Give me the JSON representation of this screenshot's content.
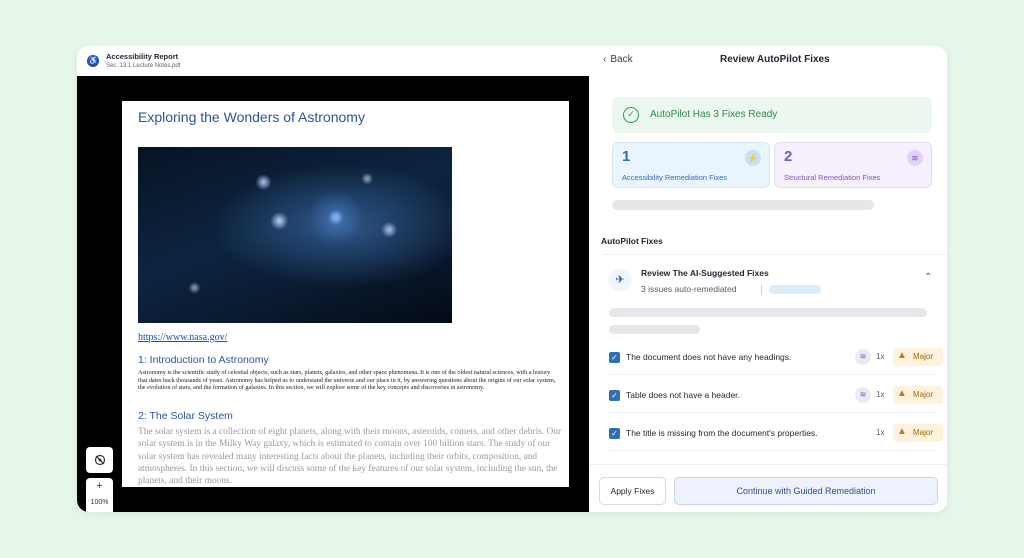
{
  "header": {
    "report_title": "Accessibility Report",
    "file_name": "Sec. 13.1 Lecture Notes.pdf"
  },
  "document": {
    "title": "Exploring the Wonders of Astronomy",
    "link": "https://www.nasa.gov/",
    "sections": [
      {
        "heading": "1: Introduction to Astronomy",
        "body": "Astronomy is the scientific study of celestial objects, such as stars, planets, galaxies, and other space phenomena. It is one of the oldest natural sciences, with a history that dates back thousands of years. Astronomy has helped us to understand the universe and our place in it, by answering questions about the origins of our solar system, the evolution of stars, and the formation of galaxies. In this section, we will explore some of the key concepts and discoveries in astronomy."
      },
      {
        "heading": "2: The Solar System",
        "body": "The solar system is a collection of eight planets, along with their moons, asteroids, comets, and other debris. Our solar system is in the Milky Way galaxy, which is estimated to contain over 100 billion stars. The study of our solar system has revealed many interesting facts about the planets, including their orbits, composition, and atmospheres. In this section, we will discuss some of the key features of our solar system, including the sun, the planets, and their moons."
      }
    ]
  },
  "viewer_controls": {
    "zoom_in": "+",
    "zoom_level": "100%",
    "zoom_out": "−"
  },
  "panel": {
    "back_label": "Back",
    "title": "Review AutoPilot Fixes",
    "ready_message": "AutoPilot Has 3 Fixes Ready",
    "cards": [
      {
        "count": "1",
        "label": "Accessibility Remediation Fixes",
        "icon": "lightning-icon"
      },
      {
        "count": "2",
        "label": "Structural Remediation Fixes",
        "icon": "layers-icon"
      }
    ],
    "section_label": "AutoPilot Fixes",
    "group": {
      "title": "Review The AI-Suggested Fixes",
      "subtitle": "3 issues auto-remediated",
      "icon": "plane-icon"
    },
    "issues": [
      {
        "text": "The document does not have any headings.",
        "count": "1x",
        "severity": "Major",
        "structural": true
      },
      {
        "text": "Table does not have a header.",
        "count": "1x",
        "severity": "Major",
        "structural": true
      },
      {
        "text": "The title is missing from the document's properties.",
        "count": "1x",
        "severity": "Major",
        "structural": false
      }
    ],
    "apply_button": "Apply Fixes",
    "guided_button": "Continue with Guided Remediation"
  },
  "colors": {
    "background": "#e6f6e9",
    "success": "#2e9a53",
    "accent_blue": "#2f6fb8",
    "accent_purple": "#7e58b8",
    "major_badge": "#fdf2dc"
  }
}
